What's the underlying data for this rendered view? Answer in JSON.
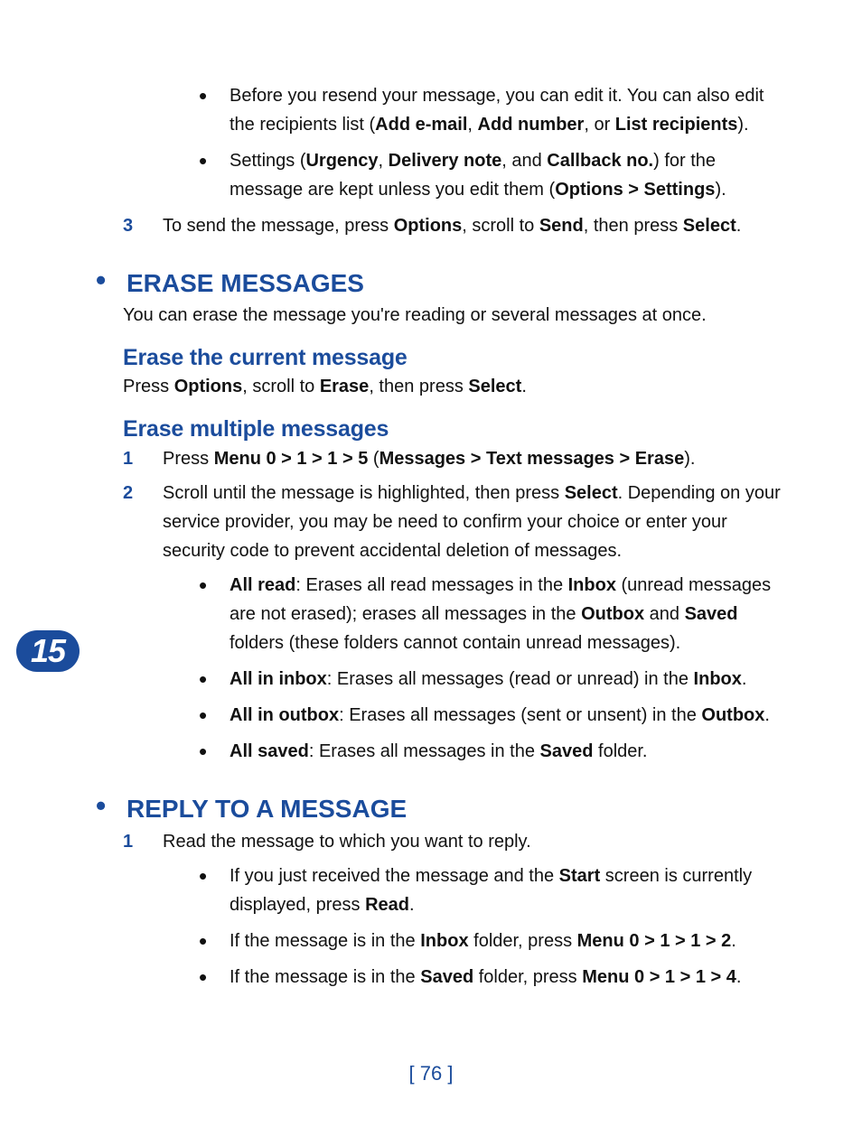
{
  "chapter": "15",
  "pagenum": "[ 76 ]",
  "topBullets": [
    {
      "pre": "Before you resend your message, you can edit it. You can also edit the recipients list (",
      "b1": "Add e-mail",
      "c1": ", ",
      "b2": "Add number",
      "c2": ", or ",
      "b3": "List recipients",
      "post": ")."
    },
    {
      "pre": "Settings (",
      "b1": "Urgency",
      "c1": ", ",
      "b2": "Delivery note",
      "c2": ", and ",
      "b3": "Callback no.",
      "mid": ") for the message are kept unless you edit them (",
      "b4": "Options > Settings",
      "post": ")."
    }
  ],
  "step3": {
    "n": "3",
    "pre": "To send the message, press ",
    "b1": "Options",
    "c1": ", scroll to ",
    "b2": "Send",
    "c2": ", then press ",
    "b3": "Select",
    "post": "."
  },
  "h_erase": "ERASE MESSAGES",
  "erase_intro": "You can erase the message you're reading or several messages at once.",
  "h_erase_cur": "Erase the current message",
  "erase_cur": {
    "pre": "Press ",
    "b1": "Options",
    "c1": ", scroll to ",
    "b2": "Erase",
    "c2": ", then press ",
    "b3": "Select",
    "post": "."
  },
  "h_erase_mul": "Erase multiple messages",
  "mul_steps": [
    {
      "n": "1",
      "pre": "Press ",
      "b1": "Menu 0 > 1 > 1 > 5",
      "mid": " (",
      "b2": "Messages > Text messages > Erase",
      "post": ")."
    },
    {
      "n": "2",
      "pre": "Scroll until the message is highlighted, then press ",
      "b1": "Select",
      "post": ". Depending on your service provider, you may be need to confirm your choice or enter your security code to prevent accidental deletion of messages."
    }
  ],
  "mul_bullets": [
    {
      "b1": "All read",
      "c1": ": Erases all read messages in the ",
      "b2": "Inbox",
      "mid": " (unread messages are not erased); erases all messages in the ",
      "b3": "Outbox",
      "c2": " and ",
      "b4": "Saved",
      "post": " folders (these folders cannot contain unread messages)."
    },
    {
      "b1": "All in inbox",
      "c1": ": Erases all messages (read or unread) in the ",
      "b2": "Inbox",
      "post": "."
    },
    {
      "b1": "All in outbox",
      "c1": ": Erases all messages (sent or unsent) in the ",
      "b2": "Outbox",
      "post": "."
    },
    {
      "b1": "All saved",
      "c1": ": Erases all messages in the ",
      "b2": "Saved",
      "post": " folder."
    }
  ],
  "h_reply": "REPLY TO A MESSAGE",
  "reply_step": {
    "n": "1",
    "txt": "Read the message to which you want to reply."
  },
  "reply_bullets": [
    {
      "pre": "If you just received the message and the ",
      "b1": "Start",
      "mid": " screen is currently displayed, press ",
      "b2": "Read",
      "post": "."
    },
    {
      "pre": "If the message is in the ",
      "b1": "Inbox",
      "mid": " folder, press ",
      "b2": "Menu 0 > 1 > 1 > 2",
      "post": "."
    },
    {
      "pre": "If the message is in the ",
      "b1": "Saved",
      "mid": " folder, press ",
      "b2": "Menu 0 > 1 > 1 > 4",
      "post": "."
    }
  ]
}
